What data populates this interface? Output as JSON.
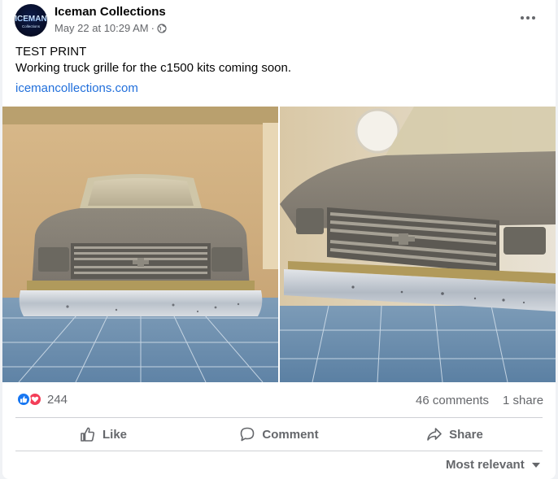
{
  "post": {
    "page_name": "Iceman Collections",
    "avatar_text": "ICEMAN",
    "avatar_subtext": "Collections",
    "timestamp": "May 22 at 10:29 AM",
    "separator": "·",
    "privacy_icon": "globe-icon",
    "more_icon": "more-horizontal-icon",
    "text_line1": "TEST PRINT",
    "text_line2": "Working truck grille for the c1500 kits coming soon.",
    "link": "icemancollections.com"
  },
  "photos": [
    {
      "subject": "model truck front grille, straight-on view"
    },
    {
      "subject": "model truck front grille, angled close-up view"
    }
  ],
  "stats": {
    "reaction_icons": [
      "like-icon",
      "love-icon"
    ],
    "reaction_count": "244",
    "comments": "46 comments",
    "shares": "1 share"
  },
  "actions": {
    "like": "Like",
    "comment": "Comment",
    "share": "Share"
  },
  "comments_sort": {
    "label": "Most relevant",
    "icon": "caret-down-icon"
  },
  "colors": {
    "link": "#216fdb",
    "secondary_text": "#65676b",
    "like_blue": "#1877f2",
    "love_red": "#f33e58"
  }
}
